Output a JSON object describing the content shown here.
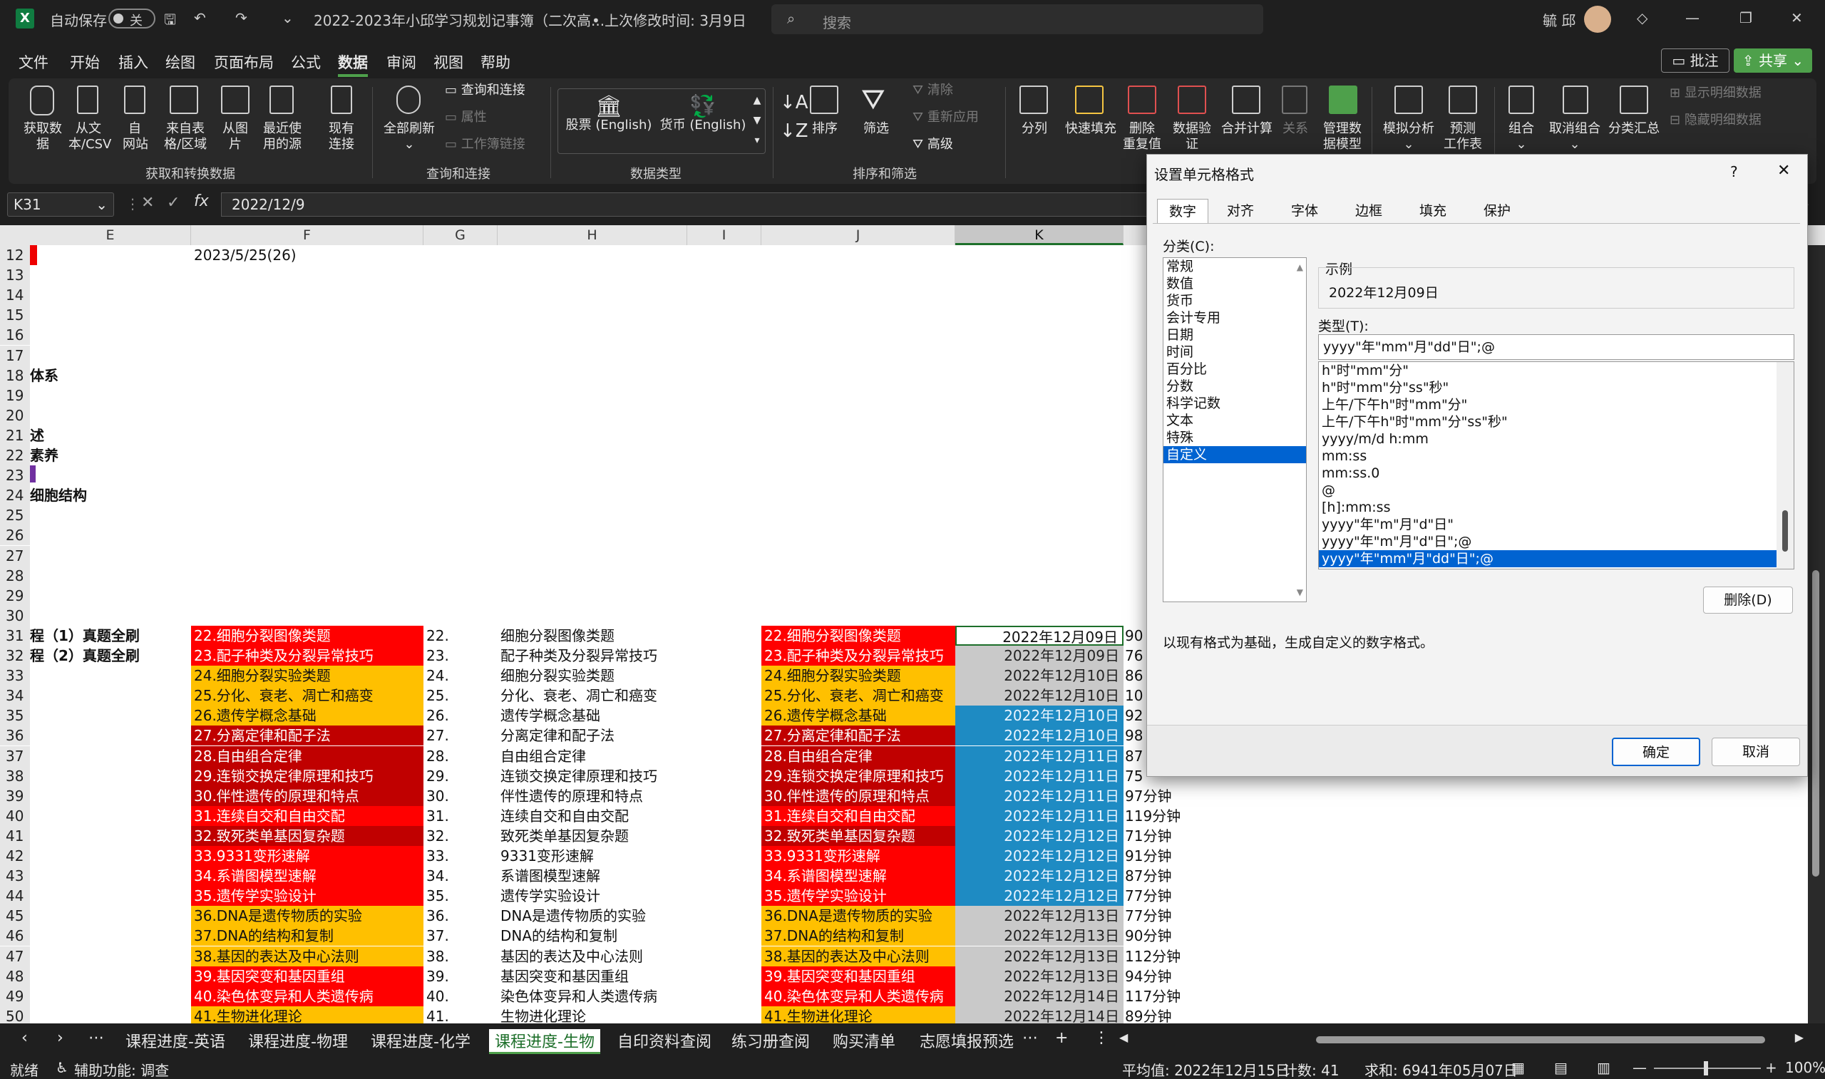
{
  "titlebar": {
    "autosave_label": "自动保存",
    "autosave_state": "关",
    "doc_title": "2022-2023年小邱学习规划记事簿（二次高...",
    "last_modified": "• 上次修改时间: 3月9日",
    "search_placeholder": "搜索",
    "user_name": "毓 邱"
  },
  "menu": [
    "文件",
    "开始",
    "插入",
    "绘图",
    "页面布局",
    "公式",
    "数据",
    "审阅",
    "视图",
    "帮助"
  ],
  "menu_active": "数据",
  "menu_right": {
    "comments": "批注",
    "share": "共享"
  },
  "ribbon": {
    "get_data": "获取数\n据",
    "from_text": "从文\n本/CSV",
    "from_web": "自\n网站",
    "from_table": "来自表\n格/区域",
    "from_picture": "从图\n片",
    "recent_sources": "最近使\n用的源",
    "existing_conn": "现有\n连接",
    "group_get": "获取和转换数据",
    "refresh_all": "全部刷新",
    "queries_conn": "查询和连接",
    "properties": "属性",
    "workbook_links": "工作簿链接",
    "group_queries": "查询和连接",
    "stocks": "股票 (English)",
    "currency": "货币 (English)",
    "group_datatypes": "数据类型",
    "sort": "排序",
    "filter": "筛选",
    "clear": "清除",
    "reapply": "重新应用",
    "advanced": "高级",
    "group_sort": "排序和筛选",
    "text_to_col": "分列",
    "flash_fill": "快速填充",
    "remove_dup": "删除\n重复值",
    "data_valid": "数据验\n证",
    "consolidate": "合并计算",
    "relations": "关系",
    "data_model": "管理数\n据模型",
    "what_if": "模拟分析",
    "forecast": "预测\n工作表",
    "group": "组合",
    "ungroup": "取消组合",
    "subtotal": "分类汇总",
    "show_detail": "显示明细数据",
    "hide_detail": "隐藏明细数据"
  },
  "formula_bar": {
    "name_box": "K31",
    "formula": "2022/12/9"
  },
  "columns": [
    "E",
    "F",
    "G",
    "H",
    "I",
    "J",
    "K"
  ],
  "rows_top": [
    {
      "r": "12",
      "e": "",
      "f": "2023/5/25(26)"
    },
    {
      "r": "13",
      "e": "",
      "f": ""
    },
    {
      "r": "14",
      "e": "",
      "f": ""
    },
    {
      "r": "15",
      "e": "",
      "f": ""
    },
    {
      "r": "16",
      "e": "",
      "f": ""
    },
    {
      "r": "17",
      "e": "",
      "f": ""
    },
    {
      "r": "18",
      "e": "体系",
      "f": ""
    },
    {
      "r": "19",
      "e": "",
      "f": ""
    },
    {
      "r": "20",
      "e": "",
      "f": ""
    },
    {
      "r": "21",
      "e": "述",
      "f": ""
    },
    {
      "r": "22",
      "e": "素养",
      "f": ""
    },
    {
      "r": "23",
      "e": "",
      "f": ""
    },
    {
      "r": "24",
      "e": "细胞结构",
      "f": ""
    },
    {
      "r": "25",
      "e": "",
      "f": ""
    },
    {
      "r": "26",
      "e": "",
      "f": ""
    },
    {
      "r": "27",
      "e": "",
      "f": ""
    },
    {
      "r": "28",
      "e": "",
      "f": ""
    },
    {
      "r": "29",
      "e": "",
      "f": ""
    },
    {
      "r": "30",
      "e": "",
      "f": ""
    }
  ],
  "rows_data": [
    {
      "r": "31",
      "e": "程（1）真题全刷",
      "f": "22.细胞分裂图像类题",
      "fc": "red",
      "g": "22.",
      "h": "细胞分裂图像类题",
      "j": "22.细胞分裂图像类题",
      "jc": "red",
      "k": "2022年12月09日",
      "kc": "sel",
      "l": "90"
    },
    {
      "r": "32",
      "e": "程（2）真题全刷",
      "f": "23.配子种类及分裂异常技巧",
      "fc": "red",
      "g": "23.",
      "h": "配子种类及分裂异常技巧",
      "j": "23.配子种类及分裂异常技巧",
      "jc": "red",
      "k": "2022年12月09日",
      "kc": "gry",
      "l": "76"
    },
    {
      "r": "33",
      "e": "",
      "f": "24.细胞分裂实验类题",
      "fc": "org",
      "g": "24.",
      "h": "细胞分裂实验类题",
      "j": "24.细胞分裂实验类题",
      "jc": "org",
      "k": "2022年12月10日",
      "kc": "gry",
      "l": "86"
    },
    {
      "r": "34",
      "e": "",
      "f": "25.分化、衰老、凋亡和癌变",
      "fc": "org",
      "g": "25.",
      "h": "分化、衰老、凋亡和癌变",
      "j": "25.分化、衰老、凋亡和癌变",
      "jc": "org",
      "k": "2022年12月10日",
      "kc": "gry",
      "l": "10"
    },
    {
      "r": "35",
      "e": "",
      "f": "26.遗传学概念基础",
      "fc": "org",
      "g": "26.",
      "h": "遗传学概念基础",
      "j": "26.遗传学概念基础",
      "jc": "org",
      "k": "2022年12月10日",
      "kc": "blu",
      "l": "92"
    },
    {
      "r": "36",
      "e": "",
      "f": "27.分离定律和配子法",
      "fc": "dred",
      "g": "27.",
      "h": "分离定律和配子法",
      "j": "27.分离定律和配子法",
      "jc": "dred",
      "k": "2022年12月10日",
      "kc": "blu",
      "l": "98"
    },
    {
      "r": "37",
      "e": "",
      "f": "28.自由组合定律",
      "fc": "dred",
      "g": "28.",
      "h": "自由组合定律",
      "j": "28.自由组合定律",
      "jc": "dred",
      "k": "2022年12月11日",
      "kc": "blu",
      "l": "87"
    },
    {
      "r": "38",
      "e": "",
      "f": "29.连锁交换定律原理和技巧",
      "fc": "dred",
      "g": "29.",
      "h": "连锁交换定律原理和技巧",
      "j": "29.连锁交换定律原理和技巧",
      "jc": "dred",
      "k": "2022年12月11日",
      "kc": "blu",
      "l": "75"
    },
    {
      "r": "39",
      "e": "",
      "f": "30.伴性遗传的原理和特点",
      "fc": "dred",
      "g": "30.",
      "h": "伴性遗传的原理和特点",
      "j": "30.伴性遗传的原理和特点",
      "jc": "dred",
      "k": "2022年12月11日",
      "kc": "blu",
      "l": "97分钟"
    },
    {
      "r": "40",
      "e": "",
      "f": "31.连续自交和自由交配",
      "fc": "red",
      "g": "31.",
      "h": "连续自交和自由交配",
      "j": "31.连续自交和自由交配",
      "jc": "red",
      "k": "2022年12月11日",
      "kc": "blu",
      "l": "119分钟"
    },
    {
      "r": "41",
      "e": "",
      "f": "32.致死类单基因复杂题",
      "fc": "dred",
      "g": "32.",
      "h": "致死类单基因复杂题",
      "j": "32.致死类单基因复杂题",
      "jc": "dred",
      "k": "2022年12月12日",
      "kc": "blu",
      "l": "71分钟"
    },
    {
      "r": "42",
      "e": "",
      "f": "33.9331变形速解",
      "fc": "red",
      "g": "33.",
      "h": "9331变形速解",
      "j": "33.9331变形速解",
      "jc": "red",
      "k": "2022年12月12日",
      "kc": "blu",
      "l": "91分钟"
    },
    {
      "r": "43",
      "e": "",
      "f": "34.系谱图模型速解",
      "fc": "red",
      "g": "34.",
      "h": "系谱图模型速解",
      "j": "34.系谱图模型速解",
      "jc": "red",
      "k": "2022年12月12日",
      "kc": "blu",
      "l": "87分钟"
    },
    {
      "r": "44",
      "e": "",
      "f": "35.遗传学实验设计",
      "fc": "red",
      "g": "35.",
      "h": "遗传学实验设计",
      "j": "35.遗传学实验设计",
      "jc": "red",
      "k": "2022年12月12日",
      "kc": "blu",
      "l": "77分钟"
    },
    {
      "r": "45",
      "e": "",
      "f": "36.DNA是遗传物质的实验",
      "fc": "org",
      "g": "36.",
      "h": "DNA是遗传物质的实验",
      "j": "36.DNA是遗传物质的实验",
      "jc": "org",
      "k": "2022年12月13日",
      "kc": "gry",
      "l": "77分钟"
    },
    {
      "r": "46",
      "e": "",
      "f": "37.DNA的结构和复制",
      "fc": "org",
      "g": "37.",
      "h": "DNA的结构和复制",
      "j": "37.DNA的结构和复制",
      "jc": "org",
      "k": "2022年12月13日",
      "kc": "gry",
      "l": "90分钟"
    },
    {
      "r": "47",
      "e": "",
      "f": "38.基因的表达及中心法则",
      "fc": "org",
      "g": "38.",
      "h": "基因的表达及中心法则",
      "j": "38.基因的表达及中心法则",
      "jc": "org",
      "k": "2022年12月13日",
      "kc": "gry",
      "l": "112分钟"
    },
    {
      "r": "48",
      "e": "",
      "f": "39.基因突变和基因重组",
      "fc": "red",
      "g": "39.",
      "h": "基因突变和基因重组",
      "j": "39.基因突变和基因重组",
      "jc": "red",
      "k": "2022年12月13日",
      "kc": "gry",
      "l": "94分钟"
    },
    {
      "r": "49",
      "e": "",
      "f": "40.染色体变异和人类遗传病",
      "fc": "red",
      "g": "40.",
      "h": "染色体变异和人类遗传病",
      "j": "40.染色体变异和人类遗传病",
      "jc": "red",
      "k": "2022年12月14日",
      "kc": "gry",
      "l": "117分钟"
    },
    {
      "r": "50",
      "e": "",
      "f": "41.生物进化理论",
      "fc": "org",
      "g": "41.",
      "h": "生物进化理论",
      "j": "41.生物进化理论",
      "jc": "org",
      "k": "2022年12月14日",
      "kc": "gry",
      "l": "89分钟"
    }
  ],
  "dialog": {
    "title": "设置单元格格式",
    "help": "?",
    "tabs": [
      "数字",
      "对齐",
      "字体",
      "边框",
      "填充",
      "保护"
    ],
    "category_label": "分类(C):",
    "categories": [
      "常规",
      "数值",
      "货币",
      "会计专用",
      "日期",
      "时间",
      "百分比",
      "分数",
      "科学记数",
      "文本",
      "特殊",
      "自定义"
    ],
    "selected_category": "自定义",
    "sample_label": "示例",
    "sample_value": "2022年12月09日",
    "type_label": "类型(T):",
    "type_value": "yyyy\"年\"mm\"月\"dd\"日\";@",
    "formats": [
      "h\"时\"mm\"分\"",
      "h\"时\"mm\"分\"ss\"秒\"",
      "上午/下午h\"时\"mm\"分\"",
      "上午/下午h\"时\"mm\"分\"ss\"秒\"",
      "yyyy/m/d h:mm",
      "mm:ss",
      "mm:ss.0",
      "@",
      "[h]:mm:ss",
      "yyyy\"年\"m\"月\"d\"日\"",
      "yyyy\"年\"m\"月\"d\"日\";@",
      "yyyy\"年\"mm\"月\"dd\"日\";@"
    ],
    "delete_btn": "删除(D)",
    "description": "以现有格式为基础，生成自定义的数字格式。",
    "ok": "确定",
    "cancel": "取消"
  },
  "sheet_tabs": [
    "课程进度-英语",
    "课程进度-物理",
    "课程进度-化学",
    "课程进度-生物",
    "自印资料查阅",
    "练习册查阅",
    "购买清单",
    "志愿填报预选"
  ],
  "active_sheet": "课程进度-生物",
  "status": {
    "ready": "就绪",
    "accessibility": "辅助功能: 调查",
    "average": "平均值: 2022年12月15日",
    "count": "计数: 41",
    "sum": "求和: 6941年05月07日",
    "zoom": "100%"
  },
  "colors": {
    "excel_green": "#107c41",
    "red": "#ff0000",
    "dark_red": "#c00000",
    "orange": "#ffc000",
    "blue": "#1e8bc3",
    "selection": "#0063d1"
  }
}
